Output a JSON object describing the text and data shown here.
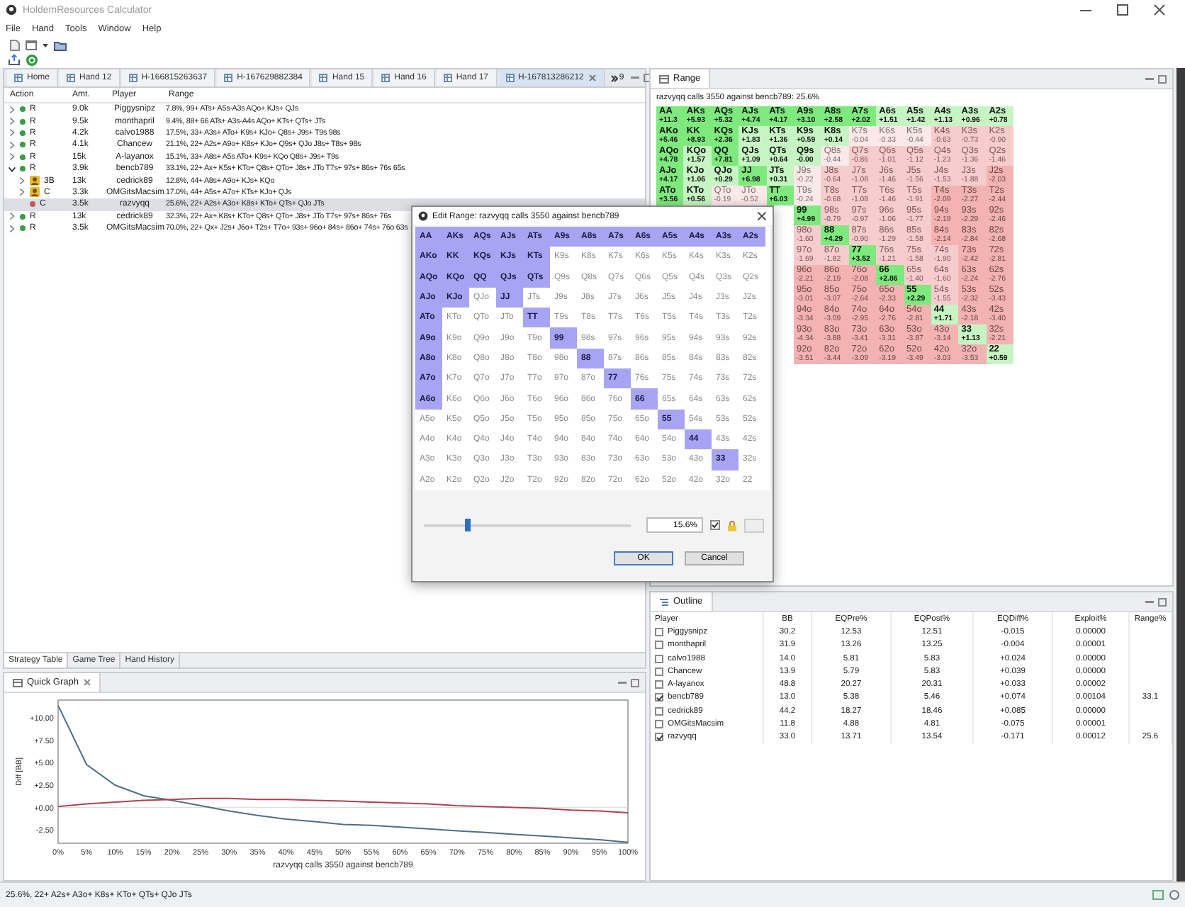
{
  "window": {
    "title": "HoldemResources Calculator"
  },
  "menu": [
    "File",
    "Hand",
    "Tools",
    "Window",
    "Help"
  ],
  "editor_tabs": [
    {
      "label": "Home",
      "selected": false
    },
    {
      "label": "Hand 12",
      "selected": false
    },
    {
      "label": "H-166815263637",
      "selected": false
    },
    {
      "label": "H-167629882384",
      "selected": false
    },
    {
      "label": "Hand 15",
      "selected": false
    },
    {
      "label": "Hand 16",
      "selected": false
    },
    {
      "label": "Hand 17",
      "selected": false
    },
    {
      "label": "H-167813286212",
      "selected": true
    }
  ],
  "tab_overflow": "9",
  "strategy_table": {
    "columns": [
      "Action",
      "Amt.",
      "Player",
      "Range"
    ],
    "rows": [
      {
        "expandable": true,
        "expanded": false,
        "selected": false,
        "kind": "dot",
        "color": "#3c9a48",
        "action": "R",
        "amount": "9.0k",
        "player": "Piggysnipz",
        "range": "7.8%, 99+ ATs+ A5s-A3s AQo+ KJs+ QJs"
      },
      {
        "expandable": true,
        "expanded": false,
        "selected": false,
        "kind": "dot",
        "color": "#3c9a48",
        "action": "R",
        "amount": "9.5k",
        "player": "monthapril",
        "range": "9.4%, 88+ 66 ATs+ A3s-A4s AQo+ KTs+ QTs+ JTs"
      },
      {
        "expandable": true,
        "expanded": false,
        "selected": false,
        "kind": "dot",
        "color": "#3c9a48",
        "action": "R",
        "amount": "4.2k",
        "player": "calvo1988",
        "range": "17.5%, 33+ A3s+ ATo+ K9s+ KJo+ Q8s+ J9s+ T9s 98s"
      },
      {
        "expandable": true,
        "expanded": false,
        "selected": false,
        "kind": "dot",
        "color": "#3c9a48",
        "action": "R",
        "amount": "4.1k",
        "player": "Chancew",
        "range": "21.1%, 22+ A2s+ A9o+ K8s+ KJo+ Q9s+ QJo J8s+ T8s+ 98s"
      },
      {
        "expandable": true,
        "expanded": false,
        "selected": false,
        "kind": "dot",
        "color": "#3c9a48",
        "action": "R",
        "amount": "15k",
        "player": "A-layanox",
        "range": "15.1%, 33+ A8s+ A5s ATo+ K9s+ KQo Q8s+ J9s+ T9s"
      },
      {
        "expandable": true,
        "expanded": true,
        "selected": false,
        "kind": "dot",
        "color": "#3c9a48",
        "action": "R",
        "amount": "3.9k",
        "player": "bencb789",
        "range": "33.1%, 22+ Ax+ K5s+ KTo+ Q8s+ QTo+ J8s+ JTo T7s+ 97s+ 86s+ 76s 65s",
        "children": [
          {
            "expandable": true,
            "expanded": false,
            "selected": false,
            "kind": "avatar",
            "action": "3B",
            "amount": "13k",
            "player": "cedrick89",
            "range": "12.8%, 44+ A8s+ A9o+ KJs+ KQo"
          },
          {
            "expandable": true,
            "expanded": false,
            "selected": false,
            "kind": "avatar",
            "action": "C",
            "amount": "3.3k",
            "player": "OMGitsMacsim",
            "range": "17.0%, 44+ A5s+ A7o+ KTs+ KJo+ QJs"
          },
          {
            "expandable": false,
            "expanded": false,
            "selected": true,
            "kind": "dot",
            "color": "#c8575a",
            "action": "C",
            "amount": "3.5k",
            "player": "razvyqq",
            "range": "25.6%, 22+ A2s+ A3o+ K8s+ KTo+ QTs+ QJo JTs"
          }
        ]
      },
      {
        "expandable": true,
        "expanded": false,
        "selected": false,
        "kind": "dot",
        "color": "#3c9a48",
        "action": "R",
        "amount": "13k",
        "player": "cedrick89",
        "range": "32.3%, 22+ Ax+ K8s+ KTo+ Q8s+ QTo+ J8s+ JTo T7s+ 97s+ 86s+ 76s"
      },
      {
        "expandable": true,
        "expanded": false,
        "selected": false,
        "kind": "dot",
        "color": "#3c9a48",
        "action": "R",
        "amount": "3.5k",
        "player": "OMGitsMacsim",
        "range": "70.0%, 22+ Qx+ J2s+ J6o+ T2s+ T7o+ 93s+ 96o+ 84s+ 86o+ 74s+ 76o 63s"
      }
    ]
  },
  "bottom_tabs": [
    {
      "label": "Strategy Table",
      "selected": true
    },
    {
      "label": "Game Tree",
      "selected": false
    },
    {
      "label": "Hand History",
      "selected": false
    }
  ],
  "quick_graph": {
    "tab": "Quick Graph",
    "chart_data": {
      "type": "line",
      "xlabel": "razvyqq calls 3550 against bencb789",
      "ylabel": "Diff [BB]",
      "x": [
        0,
        5,
        10,
        15,
        20,
        25,
        30,
        35,
        40,
        45,
        50,
        55,
        60,
        65,
        70,
        75,
        80,
        85,
        90,
        95,
        100
      ],
      "series": [
        {
          "color": "#4d6f88",
          "values": [
            11.4,
            4.8,
            2.5,
            1.3,
            0.8,
            0.2,
            -0.4,
            -0.9,
            -1.3,
            -1.6,
            -1.9,
            -2.0,
            -2.2,
            -2.4,
            -2.6,
            -2.8,
            -3.0,
            -3.2,
            -3.4,
            -3.6,
            -3.9
          ]
        },
        {
          "color": "#b0404e",
          "values": [
            0.1,
            0.4,
            0.6,
            0.8,
            0.9,
            1.0,
            1.0,
            0.9,
            0.9,
            0.8,
            0.7,
            0.6,
            0.5,
            0.4,
            0.2,
            0.1,
            0.0,
            -0.1,
            -0.3,
            -0.4,
            -0.6
          ]
        }
      ],
      "xlim": [
        0,
        100
      ],
      "ylim": [
        -4,
        12
      ],
      "xticks": [
        {
          "value": 0,
          "label": "0%"
        },
        {
          "value": 5,
          "label": "5%"
        },
        {
          "value": 10,
          "label": "10%"
        },
        {
          "value": 15,
          "label": "15%"
        },
        {
          "value": 20,
          "label": "20%"
        },
        {
          "value": 25,
          "label": "25%"
        },
        {
          "value": 30,
          "label": "30%"
        },
        {
          "value": 35,
          "label": "35%"
        },
        {
          "value": 40,
          "label": "40%"
        },
        {
          "value": 45,
          "label": "45%"
        },
        {
          "value": 50,
          "label": "50%"
        },
        {
          "value": 55,
          "label": "55%"
        },
        {
          "value": 60,
          "label": "60%"
        },
        {
          "value": 65,
          "label": "65%"
        },
        {
          "value": 70,
          "label": "70%"
        },
        {
          "value": 75,
          "label": "75%"
        },
        {
          "value": 80,
          "label": "80%"
        },
        {
          "value": 85,
          "label": "85%"
        },
        {
          "value": 90,
          "label": "90%"
        },
        {
          "value": 95,
          "label": "95%"
        },
        {
          "value": 100,
          "label": "100%"
        }
      ],
      "yticks": [
        {
          "value": 10,
          "label": "+10.00"
        },
        {
          "value": 7.5,
          "label": "+7.50"
        },
        {
          "value": 5,
          "label": "+5.00"
        },
        {
          "value": 2.5,
          "label": "+2.50"
        },
        {
          "value": 0,
          "label": "+0.00"
        },
        {
          "value": -2.5,
          "label": "-2.50"
        }
      ]
    }
  },
  "range_panel": {
    "tab": "Range",
    "subtitle": "razvyqq calls 3550 against bencb789: 25.6%",
    "rows": [
      {
        "cells": [
          {
            "hand": "AA",
            "ev": "+11.3",
            "kind": "g2"
          },
          {
            "hand": "AKs",
            "ev": "+5.93",
            "kind": "g2"
          },
          {
            "hand": "AQs",
            "ev": "+5.32",
            "kind": "g2"
          },
          {
            "hand": "AJs",
            "ev": "+4.74",
            "kind": "g2"
          },
          {
            "hand": "ATs",
            "ev": "+4.17",
            "kind": "g2"
          },
          {
            "hand": "A9s",
            "ev": "+3.10",
            "kind": "g2"
          },
          {
            "hand": "A8s",
            "ev": "+2.58",
            "kind": "g2"
          },
          {
            "hand": "A7s",
            "ev": "+2.02",
            "kind": "g2"
          },
          {
            "hand": "A6s",
            "ev": "+1.51",
            "kind": "g1"
          },
          {
            "hand": "A5s",
            "ev": "+1.42",
            "kind": "g1"
          },
          {
            "hand": "A4s",
            "ev": "+1.13",
            "kind": "g1"
          },
          {
            "hand": "A3s",
            "ev": "+0.96",
            "kind": "g1"
          },
          {
            "hand": "A2s",
            "ev": "+0.78",
            "kind": "g1"
          }
        ]
      },
      {
        "cells": [
          {
            "hand": "AKo",
            "ev": "+5.46",
            "kind": "g2"
          },
          {
            "hand": "KK",
            "ev": "+8.93",
            "kind": "g2"
          },
          {
            "hand": "KQs",
            "ev": "+2.36",
            "kind": "g2"
          },
          {
            "hand": "KJs",
            "ev": "+1.83",
            "kind": "g1"
          },
          {
            "hand": "KTs",
            "ev": "+1.36",
            "kind": "g1"
          },
          {
            "hand": "K9s",
            "ev": "+0.59",
            "kind": "g1"
          },
          {
            "hand": "K8s",
            "ev": "+0.14",
            "kind": "g1"
          },
          {
            "hand": "K7s",
            "ev": "-0.04",
            "kind": "n"
          },
          {
            "hand": "K6s",
            "ev": "-0.33",
            "kind": "n"
          },
          {
            "hand": "K5s",
            "ev": "-0.44",
            "kind": "n"
          },
          {
            "hand": "K4s",
            "ev": "-0.63",
            "kind": "r1"
          },
          {
            "hand": "K3s",
            "ev": "-0.73",
            "kind": "r1"
          },
          {
            "hand": "K2s",
            "ev": "-0.90",
            "kind": "r1"
          }
        ]
      },
      {
        "cells": [
          {
            "hand": "AQo",
            "ev": "+4.78",
            "kind": "g2"
          },
          {
            "hand": "KQo",
            "ev": "+1.57",
            "kind": "g1"
          },
          {
            "hand": "QQ",
            "ev": "+7.81",
            "kind": "g2"
          },
          {
            "hand": "QJs",
            "ev": "+1.09",
            "kind": "g1"
          },
          {
            "hand": "QTs",
            "ev": "+0.64",
            "kind": "g1"
          },
          {
            "hand": "Q9s",
            "ev": "-0.00",
            "kind": "g1"
          },
          {
            "hand": "Q8s",
            "ev": "-0.44",
            "kind": "n"
          },
          {
            "hand": "Q7s",
            "ev": "-0.86",
            "kind": "r1"
          },
          {
            "hand": "Q6s",
            "ev": "-1.01",
            "kind": "r1"
          },
          {
            "hand": "Q5s",
            "ev": "-1.12",
            "kind": "r1"
          },
          {
            "hand": "Q4s",
            "ev": "-1.23",
            "kind": "r1"
          },
          {
            "hand": "Q3s",
            "ev": "-1.36",
            "kind": "r1"
          },
          {
            "hand": "Q2s",
            "ev": "-1.46",
            "kind": "r1"
          }
        ]
      },
      {
        "cells": [
          {
            "hand": "AJo",
            "ev": "+4.17",
            "kind": "g2"
          },
          {
            "hand": "KJo",
            "ev": "+1.06",
            "kind": "g1"
          },
          {
            "hand": "QJo",
            "ev": "+0.29",
            "kind": "g1"
          },
          {
            "hand": "JJ",
            "ev": "+6.98",
            "kind": "g2"
          },
          {
            "hand": "JTs",
            "ev": "+0.31",
            "kind": "g1"
          },
          {
            "hand": "J9s",
            "ev": "-0.22",
            "kind": "n"
          },
          {
            "hand": "J8s",
            "ev": "-0.64",
            "kind": "r1"
          },
          {
            "hand": "J7s",
            "ev": "-1.08",
            "kind": "r1"
          },
          {
            "hand": "J6s",
            "ev": "-1.46",
            "kind": "r1"
          },
          {
            "hand": "J5s",
            "ev": "-1.56",
            "kind": "r1"
          },
          {
            "hand": "J4s",
            "ev": "-1.53",
            "kind": "r1"
          },
          {
            "hand": "J3s",
            "ev": "-1.88",
            "kind": "r1"
          },
          {
            "hand": "J2s",
            "ev": "-2.03",
            "kind": "r2"
          }
        ]
      },
      {
        "cells": [
          {
            "hand": "ATo",
            "ev": "+3.56",
            "kind": "g2"
          },
          {
            "hand": "KTo",
            "ev": "+0.56",
            "kind": "g1"
          },
          {
            "hand": "QTo",
            "ev": "-0.19",
            "kind": "n"
          },
          {
            "hand": "JTo",
            "ev": "-0.52",
            "kind": "n"
          },
          {
            "hand": "TT",
            "ev": "+6.03",
            "kind": "g2"
          },
          {
            "hand": "T9s",
            "ev": "-0.24",
            "kind": "n"
          },
          {
            "hand": "T8s",
            "ev": "-0.68",
            "kind": "r1"
          },
          {
            "hand": "T7s",
            "ev": "-1.08",
            "kind": "r1"
          },
          {
            "hand": "T6s",
            "ev": "-1.46",
            "kind": "r1"
          },
          {
            "hand": "T5s",
            "ev": "-1.91",
            "kind": "r1"
          },
          {
            "hand": "T4s",
            "ev": "-2.09",
            "kind": "r2"
          },
          {
            "hand": "T3s",
            "ev": "-2.27",
            "kind": "r2"
          },
          {
            "hand": "T2s",
            "ev": "-2.44",
            "kind": "r2"
          }
        ]
      },
      {
        "cells": [
          {
            "hand": "99",
            "ev": "+4.99",
            "kind": "g2"
          },
          {
            "hand": "98s",
            "ev": "-0.79",
            "kind": "r1"
          },
          {
            "hand": "97s",
            "ev": "-0.97",
            "kind": "r1"
          },
          {
            "hand": "96s",
            "ev": "-1.06",
            "kind": "r1"
          },
          {
            "hand": "95s",
            "ev": "-1.77",
            "kind": "r1"
          },
          {
            "hand": "94s",
            "ev": "-2.19",
            "kind": "r2"
          },
          {
            "hand": "93s",
            "ev": "-2.29",
            "kind": "r2"
          },
          {
            "hand": "92s",
            "ev": "-2.46",
            "kind": "r2"
          }
        ]
      },
      {
        "cells": [
          {
            "hand": "98o",
            "ev": "-1.60",
            "kind": "r1"
          },
          {
            "hand": "88",
            "ev": "+4.29",
            "kind": "g2"
          },
          {
            "hand": "87s",
            "ev": "-0.90",
            "kind": "r1"
          },
          {
            "hand": "86s",
            "ev": "-1.29",
            "kind": "r1"
          },
          {
            "hand": "85s",
            "ev": "-1.58",
            "kind": "r1"
          },
          {
            "hand": "84s",
            "ev": "-2.14",
            "kind": "r2"
          },
          {
            "hand": "83s",
            "ev": "-2.84",
            "kind": "r2"
          },
          {
            "hand": "82s",
            "ev": "-2.68",
            "kind": "r2"
          }
        ]
      },
      {
        "cells": [
          {
            "hand": "97o",
            "ev": "-1.69",
            "kind": "r1"
          },
          {
            "hand": "87o",
            "ev": "-1.82",
            "kind": "r1"
          },
          {
            "hand": "77",
            "ev": "+3.52",
            "kind": "g2"
          },
          {
            "hand": "76s",
            "ev": "-1.21",
            "kind": "r1"
          },
          {
            "hand": "75s",
            "ev": "-1.58",
            "kind": "r1"
          },
          {
            "hand": "74s",
            "ev": "-1.90",
            "kind": "r1"
          },
          {
            "hand": "73s",
            "ev": "-2.42",
            "kind": "r2"
          },
          {
            "hand": "72s",
            "ev": "-2.81",
            "kind": "r2"
          }
        ]
      },
      {
        "cells": [
          {
            "hand": "96o",
            "ev": "-2.21",
            "kind": "r2"
          },
          {
            "hand": "86o",
            "ev": "-2.19",
            "kind": "r2"
          },
          {
            "hand": "76o",
            "ev": "-2.08",
            "kind": "r2"
          },
          {
            "hand": "66",
            "ev": "+2.86",
            "kind": "g2"
          },
          {
            "hand": "65s",
            "ev": "-1.40",
            "kind": "r1"
          },
          {
            "hand": "64s",
            "ev": "-1.60",
            "kind": "r1"
          },
          {
            "hand": "63s",
            "ev": "-2.24",
            "kind": "r2"
          },
          {
            "hand": "62s",
            "ev": "-2.76",
            "kind": "r2"
          }
        ]
      },
      {
        "cells": [
          {
            "hand": "95o",
            "ev": "-3.01",
            "kind": "r2"
          },
          {
            "hand": "85o",
            "ev": "-3.07",
            "kind": "r2"
          },
          {
            "hand": "75o",
            "ev": "-2.64",
            "kind": "r2"
          },
          {
            "hand": "65o",
            "ev": "-2.33",
            "kind": "r2"
          },
          {
            "hand": "55",
            "ev": "+2.29",
            "kind": "g2"
          },
          {
            "hand": "54s",
            "ev": "-1.55",
            "kind": "r1"
          },
          {
            "hand": "53s",
            "ev": "-2.32",
            "kind": "r2"
          },
          {
            "hand": "52s",
            "ev": "-3.43",
            "kind": "r2"
          }
        ]
      },
      {
        "cells": [
          {
            "hand": "94o",
            "ev": "-3.34",
            "kind": "r2"
          },
          {
            "hand": "84o",
            "ev": "-3.09",
            "kind": "r2"
          },
          {
            "hand": "74o",
            "ev": "-2.95",
            "kind": "r2"
          },
          {
            "hand": "64o",
            "ev": "-2.76",
            "kind": "r2"
          },
          {
            "hand": "54o",
            "ev": "-2.81",
            "kind": "r2"
          },
          {
            "hand": "44",
            "ev": "+1.71",
            "kind": "g1"
          },
          {
            "hand": "43s",
            "ev": "-2.18",
            "kind": "r2"
          },
          {
            "hand": "42s",
            "ev": "-3.40",
            "kind": "r2"
          }
        ]
      },
      {
        "cells": [
          {
            "hand": "93o",
            "ev": "-4.34",
            "kind": "r2"
          },
          {
            "hand": "83o",
            "ev": "-3.88",
            "kind": "r2"
          },
          {
            "hand": "73o",
            "ev": "-3.41",
            "kind": "r2"
          },
          {
            "hand": "63o",
            "ev": "-3.31",
            "kind": "r2"
          },
          {
            "hand": "53o",
            "ev": "-3.87",
            "kind": "r2"
          },
          {
            "hand": "43o",
            "ev": "-3.14",
            "kind": "r2"
          },
          {
            "hand": "33",
            "ev": "+1.13",
            "kind": "g1"
          },
          {
            "hand": "32s",
            "ev": "-2.21",
            "kind": "r2"
          }
        ]
      },
      {
        "cells": [
          {
            "hand": "92o",
            "ev": "-3.51",
            "kind": "r2"
          },
          {
            "hand": "82o",
            "ev": "-3.44",
            "kind": "r2"
          },
          {
            "hand": "72o",
            "ev": "-3.09",
            "kind": "r2"
          },
          {
            "hand": "62o",
            "ev": "-3.19",
            "kind": "r2"
          },
          {
            "hand": "52o",
            "ev": "-3.49",
            "kind": "r2"
          },
          {
            "hand": "42o",
            "ev": "-3.03",
            "kind": "r2"
          },
          {
            "hand": "32o",
            "ev": "-3.53",
            "kind": "r2"
          },
          {
            "hand": "22",
            "ev": "+0.59",
            "kind": "g1"
          }
        ]
      }
    ]
  },
  "outline": {
    "tab": "Outline",
    "columns": [
      "Player",
      "BB",
      "EQPre%",
      "EQPost%",
      "EQDiff%",
      "Exploit%",
      "Range%"
    ],
    "rows": [
      {
        "checked": false,
        "cells": [
          "Piggysnipz",
          "30.2",
          "12.53",
          "12.51",
          "-0.015",
          "0.00000"
        ]
      },
      {
        "checked": false,
        "cells": [
          "monthapril",
          "31.9",
          "13.26",
          "13.25",
          "-0.004",
          "0.00001"
        ]
      },
      {
        "checked": false,
        "cells": [
          "calvo1988",
          "14.0",
          "5.81",
          "5.83",
          "+0.024",
          "0.00000"
        ]
      },
      {
        "checked": false,
        "cells": [
          "Chancew",
          "13.9",
          "5.79",
          "5.83",
          "+0.039",
          "0.00000"
        ]
      },
      {
        "checked": false,
        "cells": [
          "A-layanox",
          "48.8",
          "20.27",
          "20.31",
          "+0.033",
          "0.00002"
        ]
      },
      {
        "checked": true,
        "cells": [
          "bencb789",
          "13.0",
          "5.38",
          "5.46",
          "+0.074",
          "0.00104",
          "33.1"
        ]
      },
      {
        "checked": false,
        "cells": [
          "cedrick89",
          "44.2",
          "18.27",
          "18.46",
          "+0.085",
          "0.00000"
        ]
      },
      {
        "checked": false,
        "cells": [
          "OMGitsMacsim",
          "11.8",
          "4.88",
          "4.81",
          "-0.075",
          "0.00001"
        ]
      },
      {
        "checked": true,
        "cells": [
          "razvyqq",
          "33.0",
          "13.71",
          "13.54",
          "-0.171",
          "0.00012",
          "25.6"
        ]
      }
    ]
  },
  "status_bar": {
    "text": "25.6%, 22+ A2s+ A3o+ K8s+ KTo+ QTs+ QJo JTs"
  },
  "dialog": {
    "title": "Edit Range: razvyqq calls 3550 against bencb789",
    "rows": [
      {
        "cells": [
          {
            "hand": "AA",
            "selected": true
          },
          {
            "hand": "AKs",
            "selected": true
          },
          {
            "hand": "AQs",
            "selected": true
          },
          {
            "hand": "AJs",
            "selected": true
          },
          {
            "hand": "ATs",
            "selected": true
          },
          {
            "hand": "A9s",
            "selected": true
          },
          {
            "hand": "A8s",
            "selected": true
          },
          {
            "hand": "A7s",
            "selected": true
          },
          {
            "hand": "A6s",
            "selected": true
          },
          {
            "hand": "A5s",
            "selected": true
          },
          {
            "hand": "A4s",
            "selected": true
          },
          {
            "hand": "A3s",
            "selected": true
          },
          {
            "hand": "A2s",
            "selected": true
          }
        ]
      },
      {
        "cells": [
          {
            "hand": "AKo",
            "selected": true
          },
          {
            "hand": "KK",
            "selected": true
          },
          {
            "hand": "KQs",
            "selected": true
          },
          {
            "hand": "KJs",
            "selected": true
          },
          {
            "hand": "KTs",
            "selected": true
          },
          {
            "hand": "K9s",
            "selected": false
          },
          {
            "hand": "K8s",
            "selected": false
          },
          {
            "hand": "K7s",
            "selected": false
          },
          {
            "hand": "K6s",
            "selected": false
          },
          {
            "hand": "K5s",
            "selected": false
          },
          {
            "hand": "K4s",
            "selected": false
          },
          {
            "hand": "K3s",
            "selected": false
          },
          {
            "hand": "K2s",
            "selected": false
          }
        ]
      },
      {
        "cells": [
          {
            "hand": "AQo",
            "selected": true
          },
          {
            "hand": "KQo",
            "selected": true
          },
          {
            "hand": "QQ",
            "selected": true
          },
          {
            "hand": "QJs",
            "selected": true
          },
          {
            "hand": "QTs",
            "selected": true
          },
          {
            "hand": "Q9s",
            "selected": false
          },
          {
            "hand": "Q8s",
            "selected": false
          },
          {
            "hand": "Q7s",
            "selected": false
          },
          {
            "hand": "Q6s",
            "selected": false
          },
          {
            "hand": "Q5s",
            "selected": false
          },
          {
            "hand": "Q4s",
            "selected": false
          },
          {
            "hand": "Q3s",
            "selected": false
          },
          {
            "hand": "Q2s",
            "selected": false
          }
        ]
      },
      {
        "cells": [
          {
            "hand": "AJo",
            "selected": true
          },
          {
            "hand": "KJo",
            "selected": true
          },
          {
            "hand": "QJo",
            "selected": false
          },
          {
            "hand": "JJ",
            "selected": true
          },
          {
            "hand": "JTs",
            "selected": false
          },
          {
            "hand": "J9s",
            "selected": false
          },
          {
            "hand": "J8s",
            "selected": false
          },
          {
            "hand": "J7s",
            "selected": false
          },
          {
            "hand": "J6s",
            "selected": false
          },
          {
            "hand": "J5s",
            "selected": false
          },
          {
            "hand": "J4s",
            "selected": false
          },
          {
            "hand": "J3s",
            "selected": false
          },
          {
            "hand": "J2s",
            "selected": false
          }
        ]
      },
      {
        "cells": [
          {
            "hand": "ATo",
            "selected": true
          },
          {
            "hand": "KTo",
            "selected": false
          },
          {
            "hand": "QTo",
            "selected": false
          },
          {
            "hand": "JTo",
            "selected": false
          },
          {
            "hand": "TT",
            "selected": true
          },
          {
            "hand": "T9s",
            "selected": false
          },
          {
            "hand": "T8s",
            "selected": false
          },
          {
            "hand": "T7s",
            "selected": false
          },
          {
            "hand": "T6s",
            "selected": false
          },
          {
            "hand": "T5s",
            "selected": false
          },
          {
            "hand": "T4s",
            "selected": false
          },
          {
            "hand": "T3s",
            "selected": false
          },
          {
            "hand": "T2s",
            "selected": false
          }
        ]
      },
      {
        "cells": [
          {
            "hand": "A9o",
            "selected": true
          },
          {
            "hand": "K9o",
            "selected": false
          },
          {
            "hand": "Q9o",
            "selected": false
          },
          {
            "hand": "J9o",
            "selected": false
          },
          {
            "hand": "T9o",
            "selected": false
          },
          {
            "hand": "99",
            "selected": true
          },
          {
            "hand": "98s",
            "selected": false
          },
          {
            "hand": "97s",
            "selected": false
          },
          {
            "hand": "96s",
            "selected": false
          },
          {
            "hand": "95s",
            "selected": false
          },
          {
            "hand": "94s",
            "selected": false
          },
          {
            "hand": "93s",
            "selected": false
          },
          {
            "hand": "92s",
            "selected": false
          }
        ]
      },
      {
        "cells": [
          {
            "hand": "A8o",
            "selected": true
          },
          {
            "hand": "K8o",
            "selected": false
          },
          {
            "hand": "Q8o",
            "selected": false
          },
          {
            "hand": "J8o",
            "selected": false
          },
          {
            "hand": "T8o",
            "selected": false
          },
          {
            "hand": "98o",
            "selected": false
          },
          {
            "hand": "88",
            "selected": true
          },
          {
            "hand": "87s",
            "selected": false
          },
          {
            "hand": "86s",
            "selected": false
          },
          {
            "hand": "85s",
            "selected": false
          },
          {
            "hand": "84s",
            "selected": false
          },
          {
            "hand": "83s",
            "selected": false
          },
          {
            "hand": "82s",
            "selected": false
          }
        ]
      },
      {
        "cells": [
          {
            "hand": "A7o",
            "selected": true
          },
          {
            "hand": "K7o",
            "selected": false
          },
          {
            "hand": "Q7o",
            "selected": false
          },
          {
            "hand": "J7o",
            "selected": false
          },
          {
            "hand": "T7o",
            "selected": false
          },
          {
            "hand": "97o",
            "selected": false
          },
          {
            "hand": "87o",
            "selected": false
          },
          {
            "hand": "77",
            "selected": true
          },
          {
            "hand": "76s",
            "selected": false
          },
          {
            "hand": "75s",
            "selected": false
          },
          {
            "hand": "74s",
            "selected": false
          },
          {
            "hand": "73s",
            "selected": false
          },
          {
            "hand": "72s",
            "selected": false
          }
        ]
      },
      {
        "cells": [
          {
            "hand": "A6o",
            "selected": true
          },
          {
            "hand": "K6o",
            "selected": false
          },
          {
            "hand": "Q6o",
            "selected": false
          },
          {
            "hand": "J6o",
            "selected": false
          },
          {
            "hand": "T6o",
            "selected": false
          },
          {
            "hand": "96o",
            "selected": false
          },
          {
            "hand": "86o",
            "selected": false
          },
          {
            "hand": "76o",
            "selected": false
          },
          {
            "hand": "66",
            "selected": true
          },
          {
            "hand": "65s",
            "selected": false
          },
          {
            "hand": "64s",
            "selected": false
          },
          {
            "hand": "63s",
            "selected": false
          },
          {
            "hand": "62s",
            "selected": false
          }
        ]
      },
      {
        "cells": [
          {
            "hand": "A5o",
            "selected": false
          },
          {
            "hand": "K5o",
            "selected": false
          },
          {
            "hand": "Q5o",
            "selected": false
          },
          {
            "hand": "J5o",
            "selected": false
          },
          {
            "hand": "T5o",
            "selected": false
          },
          {
            "hand": "95o",
            "selected": false
          },
          {
            "hand": "85o",
            "selected": false
          },
          {
            "hand": "75o",
            "selected": false
          },
          {
            "hand": "65o",
            "selected": false
          },
          {
            "hand": "55",
            "selected": true
          },
          {
            "hand": "54s",
            "selected": false
          },
          {
            "hand": "53s",
            "selected": false
          },
          {
            "hand": "52s",
            "selected": false
          }
        ]
      },
      {
        "cells": [
          {
            "hand": "A4o",
            "selected": false
          },
          {
            "hand": "K4o",
            "selected": false
          },
          {
            "hand": "Q4o",
            "selected": false
          },
          {
            "hand": "J4o",
            "selected": false
          },
          {
            "hand": "T4o",
            "selected": false
          },
          {
            "hand": "94o",
            "selected": false
          },
          {
            "hand": "84o",
            "selected": false
          },
          {
            "hand": "74o",
            "selected": false
          },
          {
            "hand": "64o",
            "selected": false
          },
          {
            "hand": "54o",
            "selected": false
          },
          {
            "hand": "44",
            "selected": true
          },
          {
            "hand": "43s",
            "selected": false
          },
          {
            "hand": "42s",
            "selected": false
          }
        ]
      },
      {
        "cells": [
          {
            "hand": "A3o",
            "selected": false
          },
          {
            "hand": "K3o",
            "selected": false
          },
          {
            "hand": "Q3o",
            "selected": false
          },
          {
            "hand": "J3o",
            "selected": false
          },
          {
            "hand": "T3o",
            "selected": false
          },
          {
            "hand": "93o",
            "selected": false
          },
          {
            "hand": "83o",
            "selected": false
          },
          {
            "hand": "73o",
            "selected": false
          },
          {
            "hand": "63o",
            "selected": false
          },
          {
            "hand": "53o",
            "selected": false
          },
          {
            "hand": "43o",
            "selected": false
          },
          {
            "hand": "33",
            "selected": true
          },
          {
            "hand": "32s",
            "selected": false
          }
        ]
      },
      {
        "cells": [
          {
            "hand": "A2o",
            "selected": false
          },
          {
            "hand": "K2o",
            "selected": false
          },
          {
            "hand": "Q2o",
            "selected": false
          },
          {
            "hand": "J2o",
            "selected": false
          },
          {
            "hand": "T2o",
            "selected": false
          },
          {
            "hand": "92o",
            "selected": false
          },
          {
            "hand": "82o",
            "selected": false
          },
          {
            "hand": "72o",
            "selected": false
          },
          {
            "hand": "62o",
            "selected": false
          },
          {
            "hand": "52o",
            "selected": false
          },
          {
            "hand": "42o",
            "selected": false
          },
          {
            "hand": "32o",
            "selected": false
          },
          {
            "hand": "22",
            "selected": false
          }
        ]
      }
    ],
    "slider": {
      "level": 0.21
    },
    "percent": "15.6%",
    "lock_checked": true,
    "buttons": [
      "OK",
      "Cancel"
    ]
  }
}
